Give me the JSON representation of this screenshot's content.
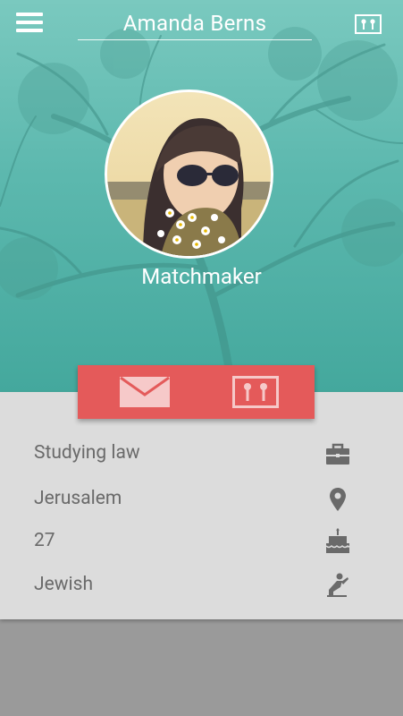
{
  "header": {
    "title": "Amanda Berns"
  },
  "profile": {
    "role": "Matchmaker"
  },
  "details": [
    {
      "label": "Studying law",
      "icon": "briefcase-icon"
    },
    {
      "label": "Jerusalem",
      "icon": "location-pin-icon"
    },
    {
      "label": "27",
      "icon": "birthday-cake-icon"
    },
    {
      "label": "Jewish",
      "icon": "praying-person-icon"
    }
  ],
  "colors": {
    "accent": "#e45a5a",
    "hero_teal": "#5cb8ae",
    "panel": "#dcdcdc",
    "text_muted": "#6a6a6a"
  }
}
